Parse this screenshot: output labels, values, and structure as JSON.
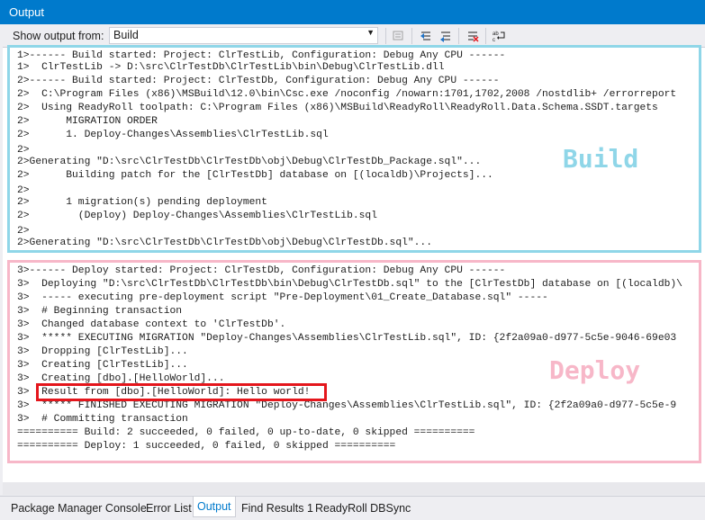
{
  "window": {
    "title": "Output"
  },
  "toolbar": {
    "show_label": "Show output from:",
    "source_value": "Build"
  },
  "output_lines": [
    "1>------ Build started: Project: ClrTestLib, Configuration: Debug Any CPU ------",
    "1>  ClrTestLib -> D:\\src\\ClrTestDb\\ClrTestLib\\bin\\Debug\\ClrTestLib.dll",
    "2>------ Build started: Project: ClrTestDb, Configuration: Debug Any CPU ------",
    "2>  C:\\Program Files (x86)\\MSBuild\\12.0\\bin\\Csc.exe /noconfig /nowarn:1701,1702,2008 /nostdlib+ /errorreport",
    "2>  Using ReadyRoll toolpath: C:\\Program Files (x86)\\MSBuild\\ReadyRoll\\ReadyRoll.Data.Schema.SSDT.targets",
    "2>      MIGRATION ORDER",
    "2>      1. Deploy-Changes\\Assemblies\\ClrTestLib.sql",
    "2>",
    "2>Generating \"D:\\src\\ClrTestDb\\ClrTestDb\\obj\\Debug\\ClrTestDb_Package.sql\"...",
    "2>      Building patch for the [ClrTestDb] database on [(localdb)\\Projects]...",
    "2>",
    "2>      1 migration(s) pending deployment",
    "2>        (Deploy) Deploy-Changes\\Assemblies\\ClrTestLib.sql",
    "2>",
    "2>Generating \"D:\\src\\ClrTestDb\\ClrTestDb\\obj\\Debug\\ClrTestDb.sql\"...",
    "3>------ Deploy started: Project: ClrTestDb, Configuration: Debug Any CPU ------",
    "3>  Deploying \"D:\\src\\ClrTestDb\\ClrTestDb\\bin\\Debug\\ClrTestDb.sql\" to the [ClrTestDb] database on [(localdb)\\",
    "3>  ----- executing pre-deployment script \"Pre-Deployment\\01_Create_Database.sql\" -----",
    "3>  # Beginning transaction",
    "3>  Changed database context to 'ClrTestDb'.",
    "3>  ***** EXECUTING MIGRATION \"Deploy-Changes\\Assemblies\\ClrTestLib.sql\", ID: {2f2a09a0-d977-5c5e-9046-69e03",
    "3>  Dropping [ClrTestLib]...",
    "3>  Creating [ClrTestLib]...",
    "3>  Creating [dbo].[HelloWorld]...",
    "3>  Result from [dbo].[HelloWorld]: Hello world!",
    "3>  ***** FINISHED EXECUTING MIGRATION \"Deploy-Changes\\Assemblies\\ClrTestLib.sql\", ID: {2f2a09a0-d977-5c5e-9",
    "3>  # Committing transaction",
    "========== Build: 2 succeeded, 0 failed, 0 up-to-date, 0 skipped ==========",
    "========== Deploy: 1 succeeded, 0 failed, 0 skipped =========="
  ],
  "annotations": {
    "build_label": "Build",
    "deploy_label": "Deploy"
  },
  "colors": {
    "accent": "#007acc",
    "build_box": "#8fd6e8",
    "deploy_box": "#f7b7c8",
    "highlight": "#e4161c"
  },
  "tabs": [
    {
      "label": "Package Manager Console"
    },
    {
      "label": "Error List"
    },
    {
      "label": "Output",
      "active": true
    },
    {
      "label": "Find Results 1"
    },
    {
      "label": "ReadyRoll DBSync"
    }
  ]
}
